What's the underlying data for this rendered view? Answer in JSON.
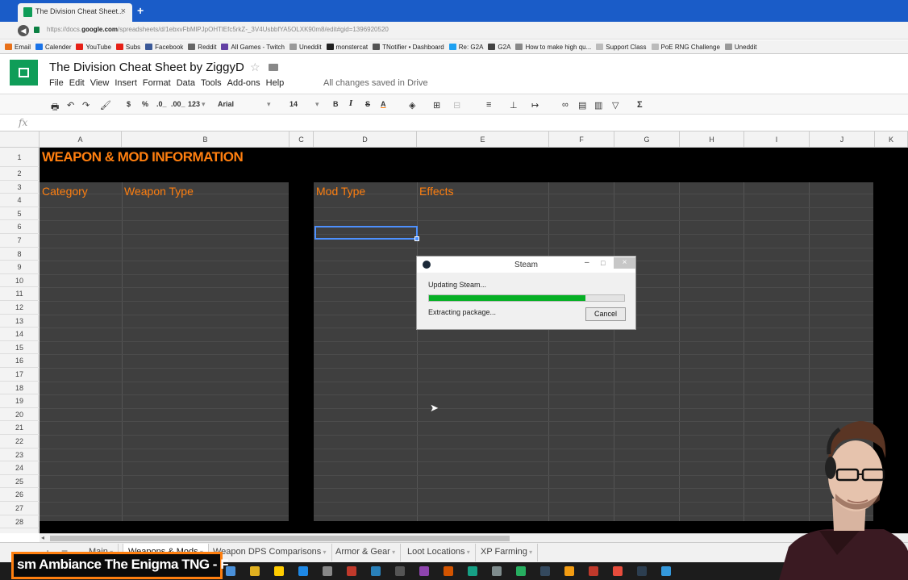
{
  "browser": {
    "tab_title": "The Division Cheat Sheet...",
    "tab_close": "×",
    "new_tab": "+",
    "url_prefix": "https://docs.",
    "url_host": "google.com",
    "url_rest": "/spreadsheets/d/1ebxvFbMlPJpOHTlEfc5rkZ-_3V4UsbbfYA5OLXK90m8/edit#gid=1396920520",
    "bookmarks": [
      {
        "label": "Email",
        "color": "#e8711a",
        "icon": "cp-icon"
      },
      {
        "label": "Calender",
        "color": "#1a73e8",
        "icon": "calendar-icon"
      },
      {
        "label": "YouTube",
        "color": "#e62117",
        "icon": "youtube-icon"
      },
      {
        "label": "Subs",
        "color": "#e62117",
        "icon": "youtube-icon"
      },
      {
        "label": "Facebook",
        "color": "#3b5998",
        "icon": "facebook-icon"
      },
      {
        "label": "Reddit",
        "color": "#666666",
        "icon": "reddit-icon"
      },
      {
        "label": "All Games - Twitch",
        "color": "#6441a5",
        "icon": "twitch-icon"
      },
      {
        "label": "Uneddit",
        "color": "#999999",
        "icon": "scissors-icon"
      },
      {
        "label": "monstercat",
        "color": "#222222",
        "icon": "monstercat-icon"
      },
      {
        "label": "TNotifier • Dashboard",
        "color": "#555555",
        "icon": "tn-icon"
      },
      {
        "label": "Re: G2A",
        "color": "#1da1f2",
        "icon": "twitter-icon"
      },
      {
        "label": "G2A",
        "color": "#444444",
        "icon": "g2a-icon"
      },
      {
        "label": "How to make high qu...",
        "color": "#888888",
        "icon": "globe-icon"
      },
      {
        "label": "Support Class",
        "color": "#bbbbbb",
        "icon": "page-icon"
      },
      {
        "label": "PoE RNG Challenge",
        "color": "#bbbbbb",
        "icon": "page-icon"
      },
      {
        "label": "Uneddit",
        "color": "#999999",
        "icon": "scissors-icon"
      }
    ]
  },
  "sheets": {
    "title": "The Division Cheat Sheet by ZiggyD",
    "menus": [
      "File",
      "Edit",
      "View",
      "Insert",
      "Format",
      "Data",
      "Tools",
      "Add-ons",
      "Help"
    ],
    "saved_status": "All changes saved in Drive",
    "toolbar": {
      "currency": "$",
      "percent": "%",
      "dec_less": ".0_",
      "dec_more": ".00_",
      "more_formats": "123",
      "font": "Arial",
      "font_size": "14",
      "bold": "B",
      "italic": "I",
      "strike": "S",
      "text_color": "A",
      "sum": "Σ"
    },
    "fx_label": "fx",
    "columns": [
      "A",
      "B",
      "C",
      "D",
      "E",
      "F",
      "G",
      "H",
      "I",
      "J",
      "K"
    ],
    "rows": [
      "1",
      "2",
      "3",
      "4",
      "5",
      "6",
      "7",
      "8",
      "9",
      "10",
      "11",
      "12",
      "13",
      "14",
      "15",
      "16",
      "17",
      "18",
      "19",
      "20",
      "21",
      "22",
      "23",
      "24",
      "25",
      "26",
      "27",
      "28"
    ],
    "sheet_title": "WEAPON & MOD INFORMATION",
    "headers": {
      "category": "Category",
      "weapon_type": "Weapon Type",
      "mod_type": "Mod Type",
      "effects": "Effects"
    },
    "sheet_tabs": [
      {
        "label": "Main",
        "active": false
      },
      {
        "label": "Weapons & Mods",
        "active": true
      },
      {
        "label": "Weapon DPS Comparisons",
        "active": false
      },
      {
        "label": "Armor & Gear",
        "active": false
      },
      {
        "label": "Loot Locations",
        "active": false
      },
      {
        "label": "XP Farming",
        "active": false
      }
    ],
    "add_sheet": "+",
    "all_sheets": "≡"
  },
  "steam_dialog": {
    "title": "Steam",
    "status": "Updating Steam...",
    "substatus": "Extracting package...",
    "cancel_label": "Cancel",
    "progress": 0.8,
    "minimize": "–",
    "maximize": "□",
    "close": "×"
  },
  "overlay": {
    "now_playing": "sm Ambiance  The Enigma TNG - F"
  },
  "colors": {
    "accent_orange": "#ff7f0f",
    "panel_gray": "#3f3f3f",
    "sheet_black": "#000000",
    "progress_green": "#06b025"
  }
}
